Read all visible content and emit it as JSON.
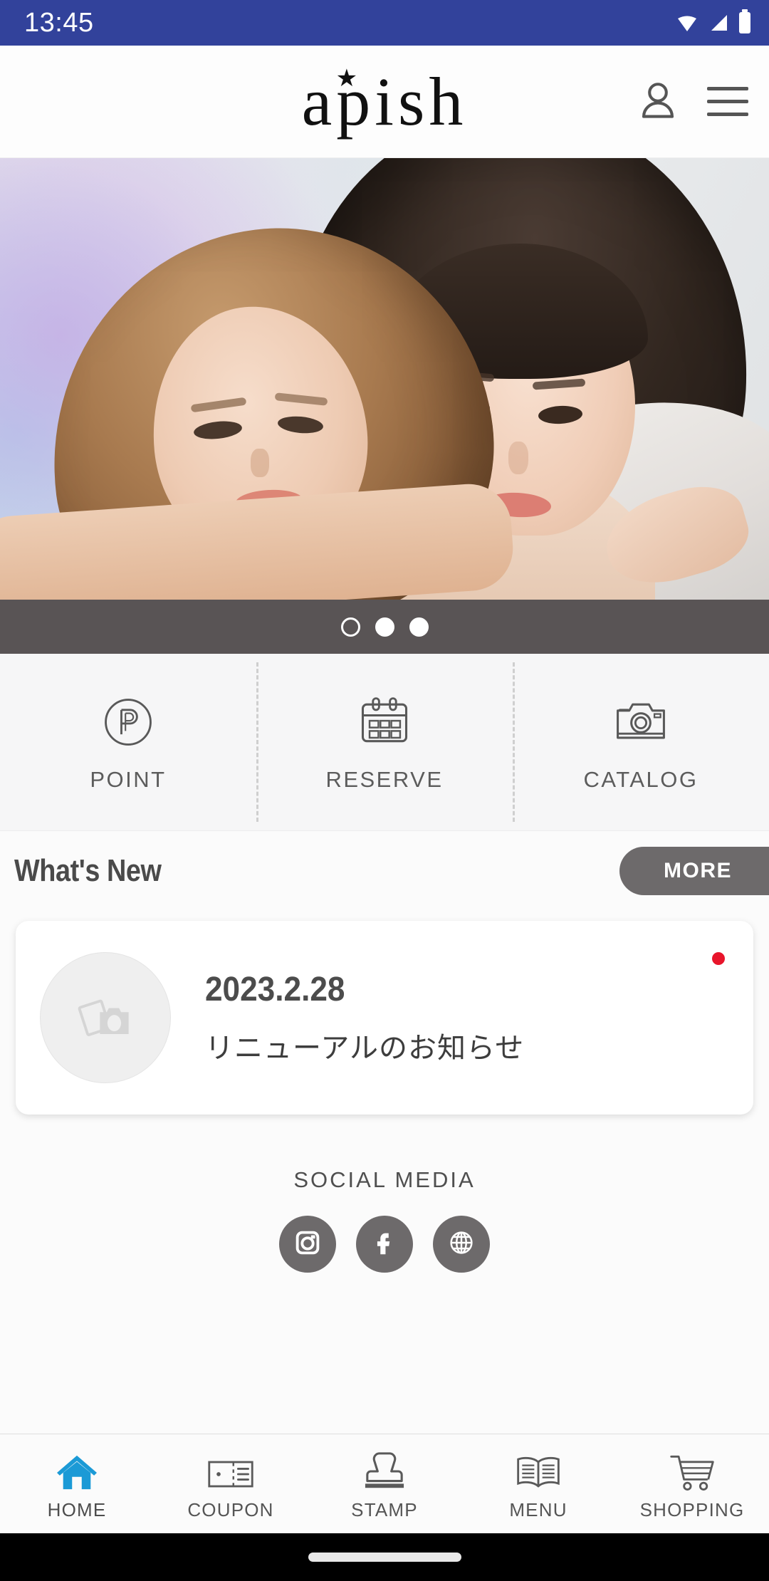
{
  "status_bar": {
    "time": "13:45",
    "icons": [
      "wifi-icon",
      "signal-icon",
      "battery-icon"
    ],
    "background_color": "#32429b"
  },
  "header": {
    "logo_text": "apish",
    "logo_star": "★",
    "account_icon": "person-icon",
    "menu_icon": "hamburger-menu-icon"
  },
  "hero": {
    "alt": "Two women with styled hair posing",
    "carousel": {
      "slide_count": 3,
      "active_index": 0,
      "dots": [
        "1",
        "2",
        "3"
      ]
    }
  },
  "quick_actions": [
    {
      "label": "POINT",
      "icon": "point-circle-p-icon"
    },
    {
      "label": "RESERVE",
      "icon": "calendar-icon"
    },
    {
      "label": "CATALOG",
      "icon": "camera-icon"
    }
  ],
  "whats_new": {
    "title": "What's New",
    "more_label": "MORE",
    "items": [
      {
        "date": "2023.2.28",
        "text": "リニューアルのお知らせ",
        "thumbnail_icon": "photo-camera-placeholder-icon",
        "unread": true
      }
    ]
  },
  "social_media": {
    "title": "SOCIAL MEDIA",
    "links": [
      {
        "name": "instagram",
        "icon": "instagram-icon"
      },
      {
        "name": "facebook",
        "icon": "facebook-icon"
      },
      {
        "name": "website",
        "icon": "globe-icon"
      }
    ]
  },
  "bottom_nav": {
    "active": "HOME",
    "active_color": "#1b9ad6",
    "items": [
      {
        "label": "HOME",
        "icon": "home-icon"
      },
      {
        "label": "COUPON",
        "icon": "ticket-icon"
      },
      {
        "label": "STAMP",
        "icon": "stamp-icon"
      },
      {
        "label": "MENU",
        "icon": "open-book-icon"
      },
      {
        "label": "SHOPPING",
        "icon": "shopping-cart-icon"
      }
    ]
  },
  "colors": {
    "status_bar": "#32429b",
    "carousel_bar": "#595455",
    "more_button": "#6d6a6b",
    "social_circle": "#6d6a6b",
    "accent_blue": "#1b9ad6",
    "badge_red": "#e8152b"
  }
}
